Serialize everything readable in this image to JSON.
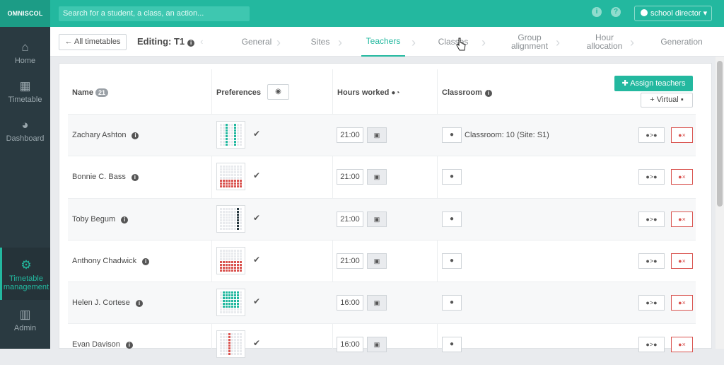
{
  "app": {
    "logo": "OMNISCOL",
    "search_placeholder": "Search for a student, a class, an action...",
    "user_label": "school director"
  },
  "sidebar": {
    "items": [
      {
        "label": "Home",
        "icon": "home-icon"
      },
      {
        "label": "Timetable",
        "icon": "calendar-icon"
      },
      {
        "label": "Dashboard",
        "icon": "dashboard-icon"
      },
      {
        "label": "Timetable management",
        "icon": "gears-icon"
      },
      {
        "label": "Admin",
        "icon": "building-icon"
      }
    ]
  },
  "subbar": {
    "back_label": "All timetables",
    "editing_label": "Editing: T1",
    "tabs": [
      {
        "label": "General"
      },
      {
        "label": "Sites"
      },
      {
        "label": "Teachers"
      },
      {
        "label": "Classes"
      },
      {
        "label": "Group alignment"
      },
      {
        "label": "Hour allocation"
      },
      {
        "label": "Generation"
      }
    ]
  },
  "table": {
    "headers": {
      "name": "Name",
      "name_count": "21",
      "preferences": "Preferences",
      "hours": "Hours worked",
      "classroom": "Classroom"
    },
    "assign_label": "Assign teachers",
    "virtual_label": "Virtual",
    "rows": [
      {
        "name": "Zachary Ashton",
        "hours": "21:00",
        "classroom": "Classroom: 10 (Site: S1)",
        "pref_color": "#23b89f"
      },
      {
        "name": "Bonnie C. Bass",
        "hours": "21:00",
        "classroom": "",
        "pref_color": "#d9534f"
      },
      {
        "name": "Toby Begum",
        "hours": "21:00",
        "classroom": "",
        "pref_color": "#2a3a41"
      },
      {
        "name": "Anthony Chadwick",
        "hours": "21:00",
        "classroom": "",
        "pref_color": "#d9534f"
      },
      {
        "name": "Helen J. Cortese",
        "hours": "16:00",
        "classroom": "",
        "pref_color": "#23b89f"
      },
      {
        "name": "Evan Davison",
        "hours": "16:00",
        "classroom": "",
        "pref_color": "#d9534f"
      }
    ]
  }
}
